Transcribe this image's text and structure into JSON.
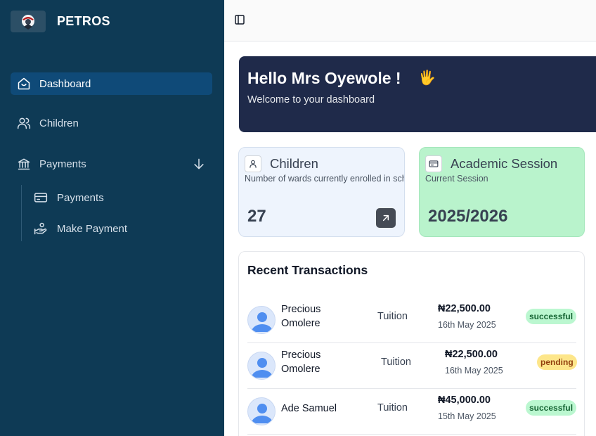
{
  "app": {
    "name": "PETROS"
  },
  "sidebar": {
    "dashboard": "Dashboard",
    "children": "Children",
    "payments": "Payments",
    "submenu": {
      "payments": "Payments",
      "make_payment": "Make Payment"
    }
  },
  "hero": {
    "title": "Hello Mrs Oyewole !",
    "wave": "🖐",
    "subtitle": "Welcome to your dashboard"
  },
  "cards": {
    "children": {
      "title": "Children",
      "subtitle": "Number of wards currently enrolled in school",
      "value": "27"
    },
    "session": {
      "title": "Academic Session",
      "subtitle": "Current Session",
      "value": "2025/2026"
    }
  },
  "transactions": {
    "title": "Recent Transactions",
    "rows": [
      {
        "name": "Precious Omolere",
        "type": "Tuition",
        "amount": "₦22,500.00",
        "date": "16th May 2025",
        "status": "successful"
      },
      {
        "name": "Precious Omolere",
        "type": "Tuition",
        "amount": "₦22,500.00",
        "date": "16th May 2025",
        "status": "pending"
      },
      {
        "name": "Ade Samuel",
        "type": "Tuition",
        "amount": "₦45,000.00",
        "date": "15th May 2025",
        "status": "successful"
      }
    ]
  },
  "colors": {
    "sidebar": "#0e3a55",
    "active": "#0f4a78",
    "hero": "#1f2a4a",
    "session_card": "#b9f3cc",
    "children_card": "#eef4fd"
  }
}
